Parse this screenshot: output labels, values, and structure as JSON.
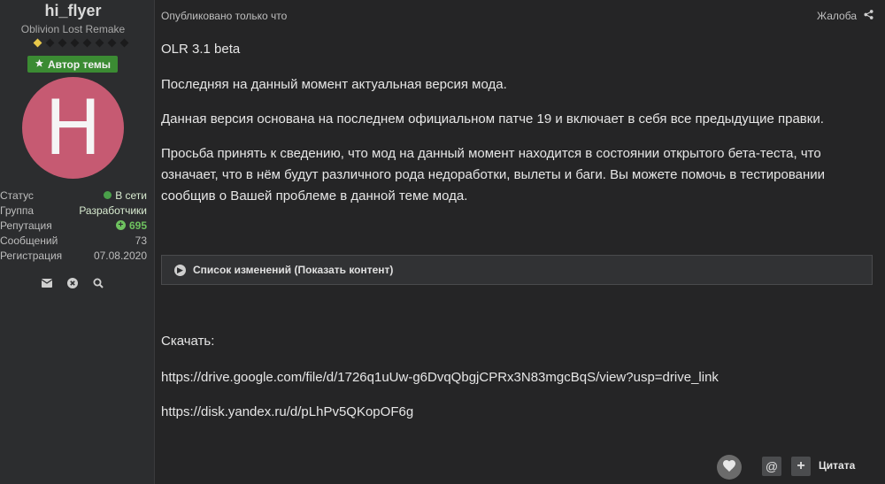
{
  "author": {
    "username": "hi_flyer",
    "title": "Oblivion Lost Remake",
    "rank_pips_total": 8,
    "rank_pips_filled": 1,
    "badge_label": "Автор темы",
    "avatar_letter": "H",
    "avatar_color": "#c65a72",
    "stats": [
      {
        "label": "Статус",
        "value": "В сети"
      },
      {
        "label": "Группа",
        "value": "Разработчики"
      },
      {
        "label": "Репутация",
        "value": "695"
      },
      {
        "label": "Сообщений",
        "value": "73"
      },
      {
        "label": "Регистрация",
        "value": "07.08.2020"
      }
    ],
    "actions": [
      "envelope-icon",
      "block-icon",
      "search-icon"
    ]
  },
  "post": {
    "meta": "Опубликовано только что",
    "report_label": "Жалоба",
    "paragraphs": [
      "OLR 3.1 beta",
      "Последняя на данный момент актуальная версия мода.",
      "Данная версия основана на последнем официальном патче 19 и включает в себя все предыдущие правки.",
      "Просьба принять к сведению, что мод на данный момент находится в состоянии открытого бета-теста, что означает, что в нём будут различного рода недоработки, вылеты и баги. Вы можете помочь в тестировании сообщив о Вашей проблеме в данной теме мода."
    ],
    "spoiler_label": "Список изменений (Показать контент)",
    "download_label": "Скачать:",
    "links": [
      "https://drive.google.com/file/d/1726q1uUw-g6DvqQbgjCPRx3N83mgcBqS/view?usp=drive_link",
      "https://disk.yandex.ru/d/pLhPv5QKopOF6g"
    ],
    "quote_label": "Цитата",
    "mention_symbol": "@",
    "plus_symbol": "+"
  },
  "colors": {
    "background": "#252526",
    "sidebar": "#2c2d2f",
    "badge_green": "#3b8b33",
    "online_green": "#4aa04a",
    "reputation_green": "#6ec25f"
  }
}
